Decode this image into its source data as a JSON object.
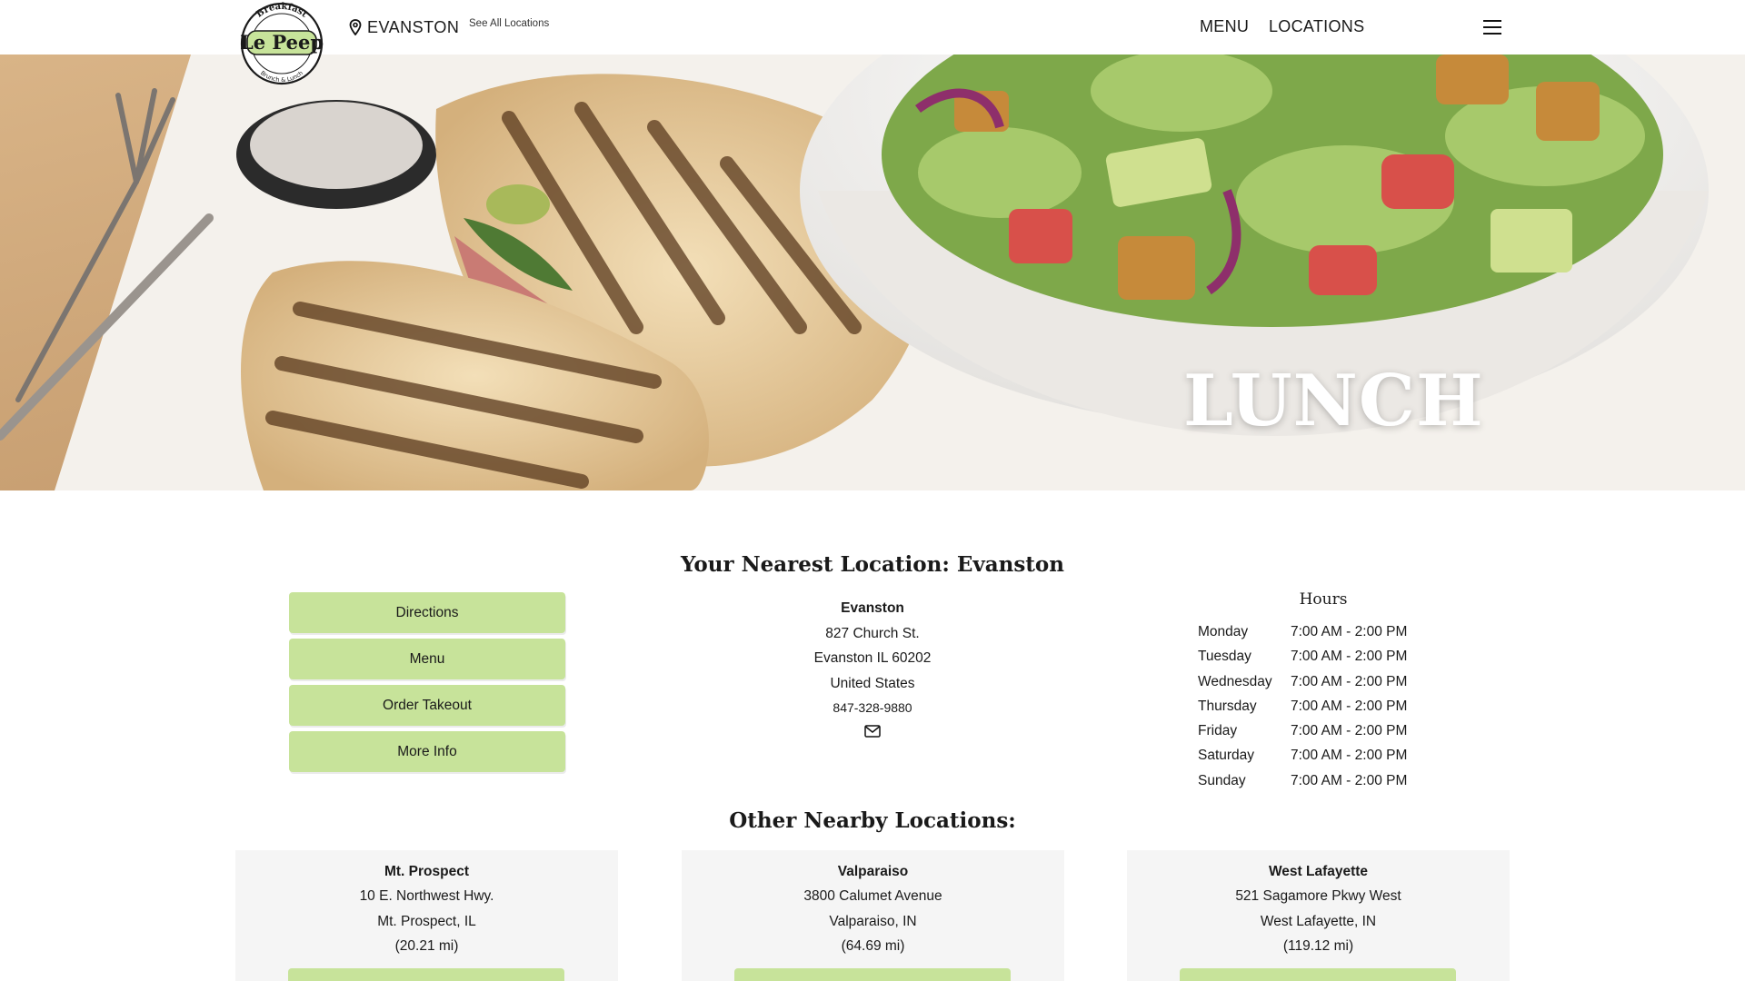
{
  "header": {
    "logo_text": "Le Peep",
    "logo_ring_top": "Breakfast",
    "logo_ring_bottom": "Brunch & Lunch",
    "current_location": "EVANSTON",
    "see_all_label": "See All Locations",
    "nav": [
      {
        "label": "MENU"
      },
      {
        "label": "LOCATIONS"
      }
    ],
    "menu_icon": "hamburger-icon",
    "location_icon": "map-pin-icon"
  },
  "hero": {
    "title": "LUNCH"
  },
  "nearest": {
    "title": "Your Nearest Location: Evanston",
    "buttons": [
      {
        "label": "Directions"
      },
      {
        "label": "Menu"
      },
      {
        "label": "Order Takeout"
      },
      {
        "label": "More Info"
      }
    ],
    "name": "Evanston",
    "street": "827 Church St.",
    "city": "Evanston IL 60202",
    "country": "United States",
    "phone": "847-328-9880",
    "email_icon": "envelope-icon",
    "hours_title": "Hours",
    "hours": [
      {
        "day": "Monday",
        "time": "7:00 AM - 2:00 PM"
      },
      {
        "day": "Tuesday",
        "time": "7:00 AM - 2:00 PM"
      },
      {
        "day": "Wednesday",
        "time": "7:00 AM - 2:00 PM"
      },
      {
        "day": "Thursday",
        "time": "7:00 AM - 2:00 PM"
      },
      {
        "day": "Friday",
        "time": "7:00 AM - 2:00 PM"
      },
      {
        "day": "Saturday",
        "time": "7:00 AM - 2:00 PM"
      },
      {
        "day": "Sunday",
        "time": "7:00 AM - 2:00 PM"
      }
    ]
  },
  "others": {
    "title": "Other Nearby Locations:",
    "locations": [
      {
        "name": "Mt. Prospect",
        "street": "10 E. Northwest Hwy.",
        "city": "Mt. Prospect, IL",
        "distance": "(20.21 mi)"
      },
      {
        "name": "Valparaiso",
        "street": "3800 Calumet Avenue",
        "city": "Valparaiso, IN",
        "distance": "(64.69 mi)"
      },
      {
        "name": "West Lafayette",
        "street": "521 Sagamore Pkwy West",
        "city": "West Lafayette, IN",
        "distance": "(119.12 mi)"
      }
    ]
  },
  "colors": {
    "accent_green": "#c7e39a",
    "card_bg": "#f5f5f5",
    "hero_text": "#ffffff"
  }
}
